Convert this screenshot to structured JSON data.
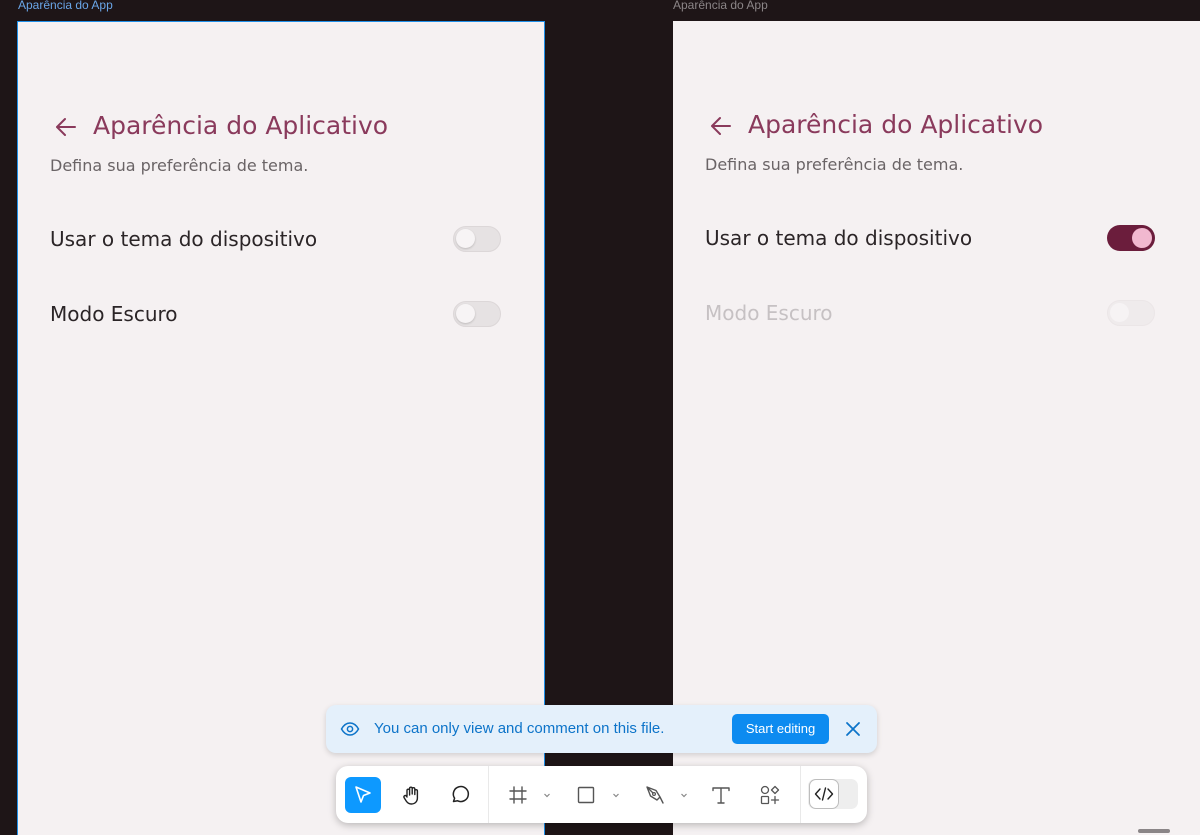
{
  "frames": [
    {
      "label": "Aparência do App",
      "screen": {
        "title": "Aparência do Aplicativo",
        "subtitle": "Defina sua preferência de tema.",
        "rows": [
          {
            "label": "Usar o tema do dispositivo",
            "on": false,
            "disabled": false
          },
          {
            "label": "Modo Escuro",
            "on": false,
            "disabled": false
          }
        ]
      }
    },
    {
      "label": "Aparência do App",
      "screen": {
        "title": "Aparência do Aplicativo",
        "subtitle": "Defina sua preferência de tema.",
        "rows": [
          {
            "label": "Usar o tema do dispositivo",
            "on": true,
            "disabled": false
          },
          {
            "label": "Modo Escuro",
            "on": false,
            "disabled": true
          }
        ]
      }
    }
  ],
  "banner": {
    "message": "You can only view and comment on this file.",
    "button_label": "Start editing",
    "icons": [
      "eye-icon",
      "close-icon"
    ]
  },
  "toolbar": {
    "tools": [
      "move-tool",
      "hand-tool",
      "comment-tool",
      "frame-tool",
      "rectangle-tool",
      "pen-tool",
      "text-tool",
      "assets-tool",
      "dev-mode-toggle"
    ],
    "active": "move-tool"
  },
  "colors": {
    "canvas": "#1e1517",
    "screen_bg": "#f5f1f2",
    "accent": "#8a3a5c",
    "toggle_on": "#6b1d3c",
    "toggle_knob_on": "#f1b8cf",
    "selection": "#1f8fe8",
    "banner_bg": "#e4f0fb",
    "primary_blue": "#0d8bf0"
  }
}
